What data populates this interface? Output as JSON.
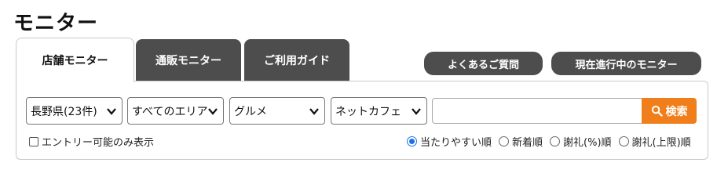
{
  "page": {
    "title": "モニター"
  },
  "tabs": [
    {
      "label": "店舗モニター",
      "active": true
    },
    {
      "label": "通販モニター",
      "active": false
    },
    {
      "label": "ご利用ガイド",
      "active": false
    }
  ],
  "links": {
    "faq": "よくあるご質問",
    "ongoing": "現在進行中のモニター"
  },
  "filters": {
    "prefecture": "長野県(23件)",
    "area": "すべてのエリア",
    "category": "グルメ",
    "subcategory": "ネットカフェ"
  },
  "search": {
    "keyword_value": "",
    "button_label": "検索"
  },
  "options": {
    "entry_only_label": "エントリー可能のみ表示",
    "entry_only_checked": false
  },
  "sort": {
    "options": [
      "当たりやすい順",
      "新着順",
      "謝礼(%)順",
      "謝礼(上限)順"
    ],
    "selected": "当たりやすい順"
  },
  "colors": {
    "accent": "#f07e1a",
    "tab_dark": "#4d4d4d",
    "radio_selected": "#1a73e8"
  }
}
